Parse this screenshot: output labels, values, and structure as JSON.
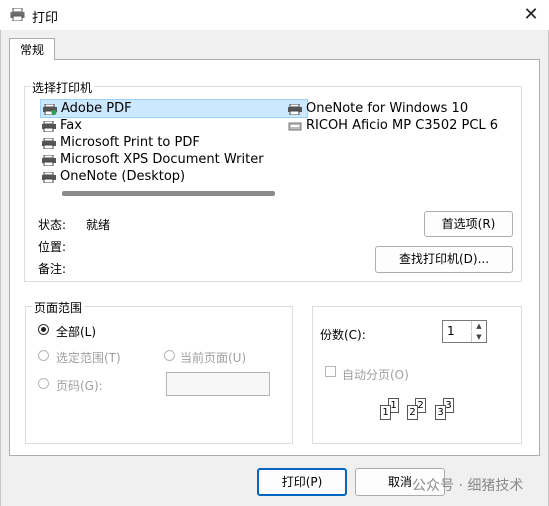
{
  "window": {
    "title": "打印",
    "close_glyph": "✕"
  },
  "tabs": [
    {
      "label": "常规"
    }
  ],
  "printer_group": {
    "legend": "选择打印机",
    "printers": [
      {
        "name": "Adobe PDF",
        "selected": true
      },
      {
        "name": "Fax"
      },
      {
        "name": "Microsoft Print to PDF"
      },
      {
        "name": "Microsoft XPS Document Writer"
      },
      {
        "name": "OneNote (Desktop)"
      },
      {
        "name": "OneNote for Windows 10"
      },
      {
        "name": "RICOH Aficio MP C3502 PCL 6"
      }
    ],
    "status_label": "状态:",
    "status_value": "就绪",
    "location_label": "位置:",
    "comment_label": "备注:",
    "preferences_button": "首选项(R)",
    "find_printer_button": "查找打印机(D)..."
  },
  "page_range": {
    "legend": "页面范围",
    "all": "全部(L)",
    "selection": "选定范围(T)",
    "current_page": "当前页面(U)",
    "pages": "页码(G):",
    "selected_option": "all"
  },
  "copies": {
    "label": "份数(C):",
    "value": "1",
    "collate": "自动分页(O)",
    "collate_checked": false,
    "collate_numbers": [
      "1",
      "1",
      "2",
      "2",
      "3",
      "3"
    ]
  },
  "footer": {
    "print_button": "打印(P)",
    "cancel_button": "取消",
    "watermark": "公众号 · 细猪技术"
  },
  "colors": {
    "accent": "#0067c0",
    "selection": "#cce8ff"
  }
}
